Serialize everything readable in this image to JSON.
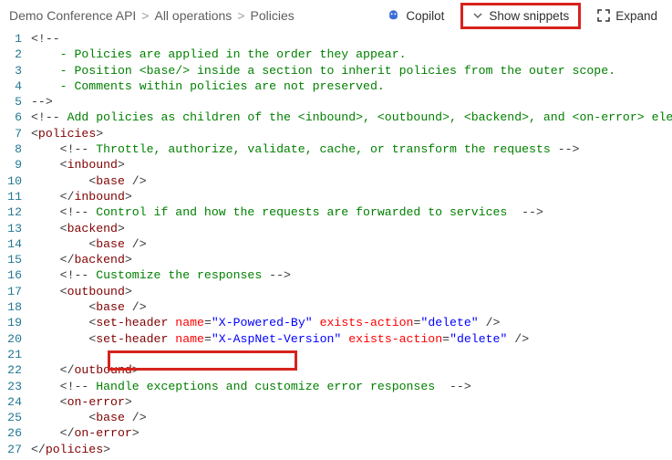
{
  "breadcrumb": {
    "item1": "Demo Conference API",
    "item2": "All operations",
    "item3": "Policies"
  },
  "toolbar": {
    "copilot_label": "Copilot",
    "snippets_label": "Show snippets",
    "expand_label": "Expand"
  },
  "editor": {
    "lines": [
      [
        {
          "cls": "c-punc",
          "t": "<!--"
        }
      ],
      [
        {
          "cls": "c-comment",
          "t": "    - Policies are applied in the order they appear."
        }
      ],
      [
        {
          "cls": "c-comment",
          "t": "    - Position <base/> inside a section to inherit policies from the outer scope."
        }
      ],
      [
        {
          "cls": "c-comment",
          "t": "    - Comments within policies are not preserved."
        }
      ],
      [
        {
          "cls": "c-punc",
          "t": "-->"
        }
      ],
      [
        {
          "cls": "c-punc",
          "t": "<!--"
        },
        {
          "cls": "c-comment",
          "t": " Add policies as children of the <inbound>, <outbound>, <backend>, and <on-error> ele"
        }
      ],
      [
        {
          "cls": "c-punc",
          "t": "<"
        },
        {
          "cls": "c-tag",
          "t": "policies"
        },
        {
          "cls": "c-punc",
          "t": ">"
        }
      ],
      [
        {
          "cls": "",
          "t": "    "
        },
        {
          "cls": "c-punc",
          "t": "<!--"
        },
        {
          "cls": "c-comment",
          "t": " Throttle, authorize, validate, cache, or transform the requests "
        },
        {
          "cls": "c-punc",
          "t": "-->"
        }
      ],
      [
        {
          "cls": "",
          "t": "    "
        },
        {
          "cls": "c-punc",
          "t": "<"
        },
        {
          "cls": "c-tag",
          "t": "inbound"
        },
        {
          "cls": "c-punc",
          "t": ">"
        }
      ],
      [
        {
          "cls": "",
          "t": "        "
        },
        {
          "cls": "c-punc",
          "t": "<"
        },
        {
          "cls": "c-tag",
          "t": "base"
        },
        {
          "cls": "c-punc",
          "t": " />"
        }
      ],
      [
        {
          "cls": "",
          "t": "    "
        },
        {
          "cls": "c-punc",
          "t": "</"
        },
        {
          "cls": "c-tag",
          "t": "inbound"
        },
        {
          "cls": "c-punc",
          "t": ">"
        }
      ],
      [
        {
          "cls": "",
          "t": "    "
        },
        {
          "cls": "c-punc",
          "t": "<!--"
        },
        {
          "cls": "c-comment",
          "t": " Control if and how the requests are forwarded to services  "
        },
        {
          "cls": "c-punc",
          "t": "-->"
        }
      ],
      [
        {
          "cls": "",
          "t": "    "
        },
        {
          "cls": "c-punc",
          "t": "<"
        },
        {
          "cls": "c-tag",
          "t": "backend"
        },
        {
          "cls": "c-punc",
          "t": ">"
        }
      ],
      [
        {
          "cls": "",
          "t": "        "
        },
        {
          "cls": "c-punc",
          "t": "<"
        },
        {
          "cls": "c-tag",
          "t": "base"
        },
        {
          "cls": "c-punc",
          "t": " />"
        }
      ],
      [
        {
          "cls": "",
          "t": "    "
        },
        {
          "cls": "c-punc",
          "t": "</"
        },
        {
          "cls": "c-tag",
          "t": "backend"
        },
        {
          "cls": "c-punc",
          "t": ">"
        }
      ],
      [
        {
          "cls": "",
          "t": "    "
        },
        {
          "cls": "c-punc",
          "t": "<!--"
        },
        {
          "cls": "c-comment",
          "t": " Customize the responses "
        },
        {
          "cls": "c-punc",
          "t": "-->"
        }
      ],
      [
        {
          "cls": "",
          "t": "    "
        },
        {
          "cls": "c-punc",
          "t": "<"
        },
        {
          "cls": "c-tag",
          "t": "outbound"
        },
        {
          "cls": "c-punc",
          "t": ">"
        }
      ],
      [
        {
          "cls": "",
          "t": "        "
        },
        {
          "cls": "c-punc",
          "t": "<"
        },
        {
          "cls": "c-tag",
          "t": "base"
        },
        {
          "cls": "c-punc",
          "t": " />"
        }
      ],
      [
        {
          "cls": "",
          "t": "        "
        },
        {
          "cls": "c-punc",
          "t": "<"
        },
        {
          "cls": "c-tag",
          "t": "set-header"
        },
        {
          "cls": "",
          "t": " "
        },
        {
          "cls": "c-attr",
          "t": "name"
        },
        {
          "cls": "c-punc",
          "t": "="
        },
        {
          "cls": "c-str",
          "t": "\"X-Powered-By\""
        },
        {
          "cls": "",
          "t": " "
        },
        {
          "cls": "c-attr",
          "t": "exists-action"
        },
        {
          "cls": "c-punc",
          "t": "="
        },
        {
          "cls": "c-str",
          "t": "\"delete\""
        },
        {
          "cls": "c-punc",
          "t": " />"
        }
      ],
      [
        {
          "cls": "",
          "t": "        "
        },
        {
          "cls": "c-punc",
          "t": "<"
        },
        {
          "cls": "c-tag",
          "t": "set-header"
        },
        {
          "cls": "",
          "t": " "
        },
        {
          "cls": "c-attr",
          "t": "name"
        },
        {
          "cls": "c-punc",
          "t": "="
        },
        {
          "cls": "c-str",
          "t": "\"X-AspNet-Version\""
        },
        {
          "cls": "",
          "t": " "
        },
        {
          "cls": "c-attr",
          "t": "exists-action"
        },
        {
          "cls": "c-punc",
          "t": "="
        },
        {
          "cls": "c-str",
          "t": "\"delete\""
        },
        {
          "cls": "c-punc",
          "t": " />"
        }
      ],
      [
        {
          "cls": "",
          "t": ""
        }
      ],
      [
        {
          "cls": "",
          "t": "    "
        },
        {
          "cls": "c-punc",
          "t": "</"
        },
        {
          "cls": "c-tag",
          "t": "outbound"
        },
        {
          "cls": "c-punc",
          "t": ">"
        }
      ],
      [
        {
          "cls": "",
          "t": "    "
        },
        {
          "cls": "c-punc",
          "t": "<!--"
        },
        {
          "cls": "c-comment",
          "t": " Handle exceptions and customize error responses  "
        },
        {
          "cls": "c-punc",
          "t": "-->"
        }
      ],
      [
        {
          "cls": "",
          "t": "    "
        },
        {
          "cls": "c-punc",
          "t": "<"
        },
        {
          "cls": "c-tag",
          "t": "on-error"
        },
        {
          "cls": "c-punc",
          "t": ">"
        }
      ],
      [
        {
          "cls": "",
          "t": "        "
        },
        {
          "cls": "c-punc",
          "t": "<"
        },
        {
          "cls": "c-tag",
          "t": "base"
        },
        {
          "cls": "c-punc",
          "t": " />"
        }
      ],
      [
        {
          "cls": "",
          "t": "    "
        },
        {
          "cls": "c-punc",
          "t": "</"
        },
        {
          "cls": "c-tag",
          "t": "on-error"
        },
        {
          "cls": "c-punc",
          "t": ">"
        }
      ],
      [
        {
          "cls": "c-punc",
          "t": "</"
        },
        {
          "cls": "c-tag",
          "t": "policies"
        },
        {
          "cls": "c-punc",
          "t": ">"
        }
      ]
    ]
  }
}
